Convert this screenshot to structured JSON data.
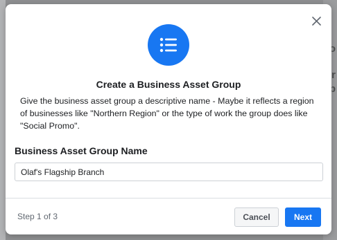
{
  "background": {
    "glyphs": [
      "o",
      "r",
      "p"
    ]
  },
  "modal": {
    "icon": "list-icon",
    "title": "Create a Business Asset Group",
    "description": "Give the business asset group a descriptive name - Maybe it reflects a region of businesses like \"Northern Region\" or the type of work the group does like \"Social Promo\".",
    "field": {
      "label": "Business Asset Group Name",
      "value": "Olaf's Flagship Branch"
    },
    "footer": {
      "step": "Step 1 of 3",
      "cancel_label": "Cancel",
      "next_label": "Next"
    }
  },
  "colors": {
    "accent": "#1877f2",
    "overlay": "#9a9b9c"
  }
}
